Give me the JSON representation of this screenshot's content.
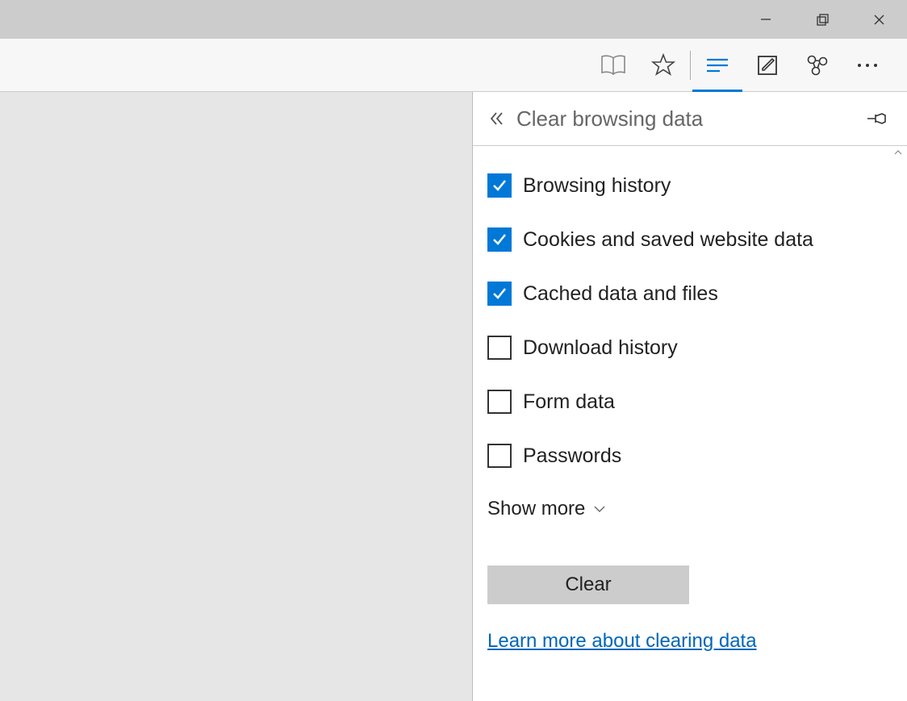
{
  "panel": {
    "title": "Clear browsing data",
    "items": [
      {
        "label": "Browsing history",
        "checked": true
      },
      {
        "label": "Cookies and saved website data",
        "checked": true
      },
      {
        "label": "Cached data and files",
        "checked": true
      },
      {
        "label": "Download history",
        "checked": false
      },
      {
        "label": "Form data",
        "checked": false
      },
      {
        "label": "Passwords",
        "checked": false
      }
    ],
    "show_more": "Show more",
    "clear_button": "Clear",
    "learn_link": "Learn more about clearing data"
  }
}
